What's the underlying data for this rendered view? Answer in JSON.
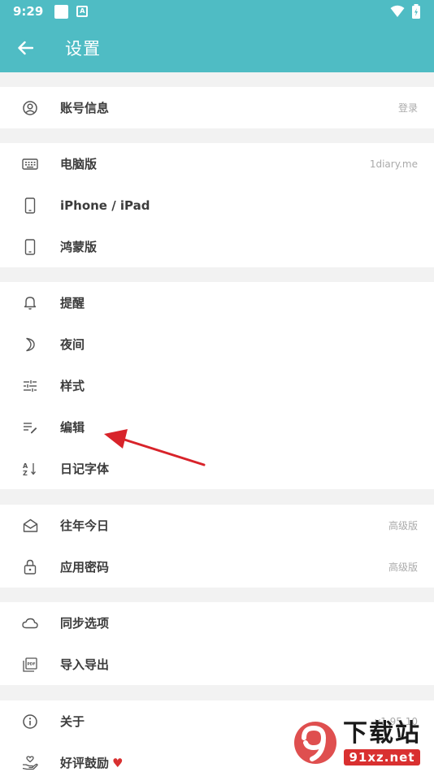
{
  "status_bar": {
    "time": "9:29",
    "a_badge": "A"
  },
  "app_bar": {
    "title": "设置"
  },
  "sections": {
    "account": {
      "label": "账号信息",
      "value": "登录"
    },
    "desktop": {
      "label": "电脑版",
      "value": "1diary.me"
    },
    "iphone": {
      "label": "iPhone / iPad"
    },
    "harmony": {
      "label": "鸿蒙版"
    },
    "reminder": {
      "label": "提醒"
    },
    "night": {
      "label": "夜间"
    },
    "style": {
      "label": "样式"
    },
    "edit": {
      "label": "编辑"
    },
    "font": {
      "label": "日记字体"
    },
    "past_years": {
      "label": "往年今日",
      "value": "高级版"
    },
    "app_password": {
      "label": "应用密码",
      "value": "高级版"
    },
    "sync": {
      "label": "同步选项"
    },
    "import_export": {
      "label": "导入导出"
    },
    "about": {
      "label": "关于",
      "value": "v1.95.10"
    },
    "rate": {
      "label": "好评鼓励",
      "heart": "♥"
    }
  },
  "watermark": {
    "big": "下载站",
    "url": "91xz.net"
  },
  "colors": {
    "accent": "#4fbcc4",
    "arrow": "#d8232a",
    "background": "#f2f2f2"
  }
}
